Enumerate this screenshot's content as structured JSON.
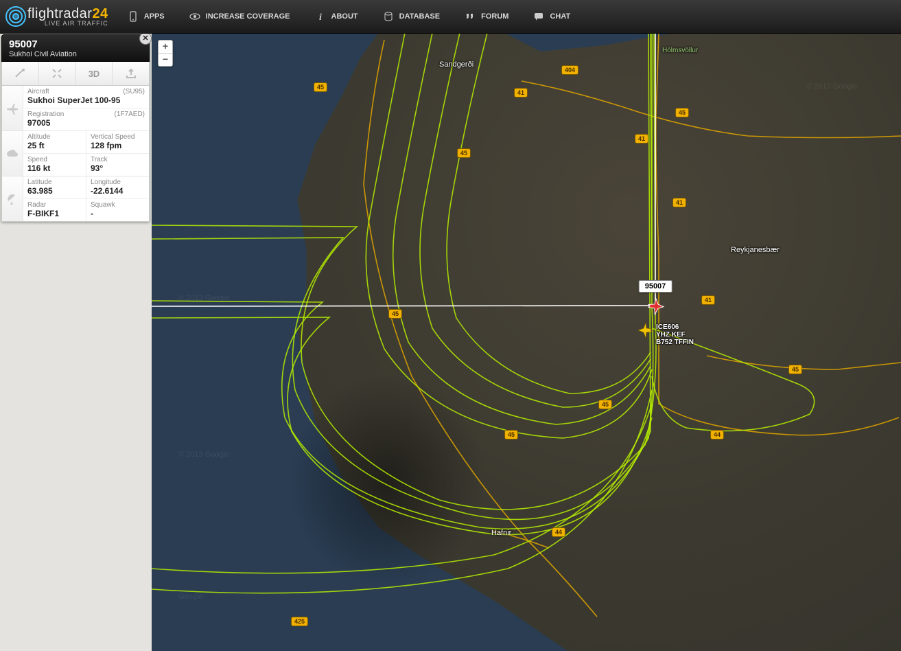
{
  "brand": {
    "name_a": "flightradar",
    "name_b": "24",
    "tagline": "LIVE AIR TRAFFIC"
  },
  "nav": {
    "apps": "APPS",
    "increase": "INCREASE COVERAGE",
    "about": "ABOUT",
    "database": "DATABASE",
    "forum": "FORUM",
    "chat": "CHAT"
  },
  "zoom": {
    "in": "+",
    "out": "−"
  },
  "panel": {
    "callsign": "95007",
    "airline": "Sukhoi Civil Aviation",
    "tools": {
      "three_d": "3D"
    },
    "aircraft": {
      "label": "Aircraft",
      "type_code": "(SU95)",
      "type_full": "Sukhoi SuperJet 100-95",
      "reg_label": "Registration",
      "reg_code": "(1F7AED)",
      "reg_value": "97005"
    },
    "flight": {
      "alt_label": "Altitude",
      "alt_value": "25 ft",
      "vs_label": "Vertical Speed",
      "vs_value": "128 fpm",
      "spd_label": "Speed",
      "spd_value": "116 kt",
      "trk_label": "Track",
      "trk_value": "93°"
    },
    "pos": {
      "lat_label": "Latitude",
      "lat_value": "63.985",
      "lon_label": "Longitude",
      "lon_value": "-22.6144",
      "radar_label": "Radar",
      "radar_value": "F-BIKF1",
      "sq_label": "Squawk",
      "sq_value": "-"
    }
  },
  "map": {
    "selected_label": "95007",
    "other_flight": {
      "line1": "ICE606",
      "line2": "YHZ KEF",
      "line3": "B752 TFFIN"
    },
    "cities": {
      "sandgerdi": "Sandgerði",
      "reykjanesbaer": "Reykjanesbær",
      "hafnir": "Hafnir",
      "holmsvollur": "Hólmsvöllur"
    },
    "shields": [
      "45",
      "404",
      "41",
      "41",
      "45",
      "45",
      "41",
      "44",
      "45",
      "45",
      "44",
      "45",
      "425",
      "41",
      "45"
    ]
  }
}
